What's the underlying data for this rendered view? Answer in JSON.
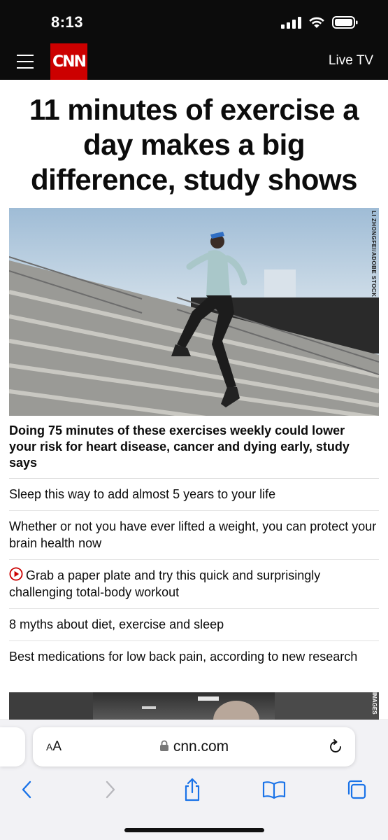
{
  "status_bar": {
    "time": "8:13"
  },
  "header": {
    "logo_text": "CNN",
    "live_tv_label": "Live TV"
  },
  "article": {
    "headline": "11 minutes of exercise a day makes a big difference, study shows",
    "image_credit": "LI ZHONGFEI/ADOBE STOCK",
    "caption": "Doing 75 minutes of these exercises weekly could lower your risk for heart disease, cancer and dying early, study says"
  },
  "related": [
    {
      "text": "Sleep this way to add almost 5 years to your life",
      "has_video": false
    },
    {
      "text": "Whether or not you have ever lifted a weight, you can protect your brain health now",
      "has_video": false
    },
    {
      "text": "Grab a paper plate and try this quick and surprisingly challenging total-body workout",
      "has_video": true
    },
    {
      "text": "8 myths about diet, exercise and sleep",
      "has_video": false
    },
    {
      "text": "Best medications for low back pain, according to new research",
      "has_video": false
    }
  ],
  "second_image_credit": "IMAGES",
  "browser": {
    "text_size_label": "AA",
    "url": "cnn.com"
  },
  "colors": {
    "brand_red": "#cc0000",
    "header_black": "#0c0c0c",
    "ios_blue": "#1a73e8"
  },
  "icons": {
    "menu": "hamburger-menu-icon",
    "video": "play-circle-icon",
    "lock": "lock-icon",
    "reload": "reload-icon",
    "back": "chevron-left-icon",
    "forward": "chevron-right-icon",
    "share": "share-icon",
    "bookmarks": "book-icon",
    "tabs": "tabs-icon"
  }
}
